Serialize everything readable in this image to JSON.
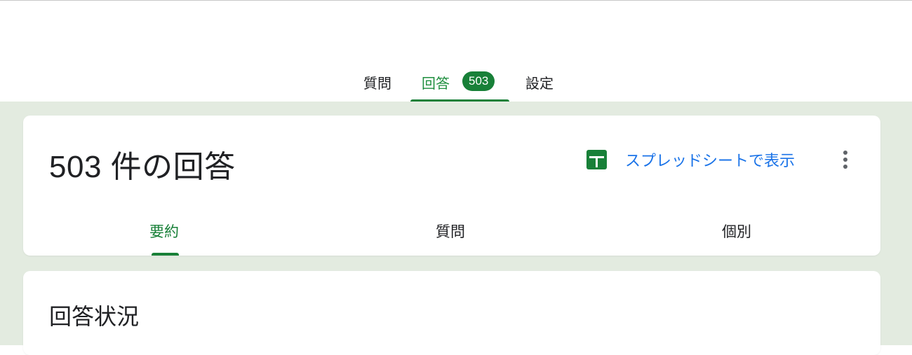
{
  "top_tabs": {
    "questions": "質問",
    "responses": "回答",
    "response_count": "503",
    "settings": "設定"
  },
  "summary_card": {
    "title": "503 件の回答",
    "sheets_link": "スプレッドシートで表示",
    "sheets_icon": "google-sheets-icon",
    "more_icon": "more-vert-icon",
    "sub_tabs": {
      "summary": "要約",
      "questions": "質問",
      "individual": "個別"
    }
  },
  "status_card": {
    "title": "回答状況"
  },
  "colors": {
    "accent_green": "#188038",
    "link_blue": "#1a73e8",
    "background": "#e3ebe0"
  }
}
